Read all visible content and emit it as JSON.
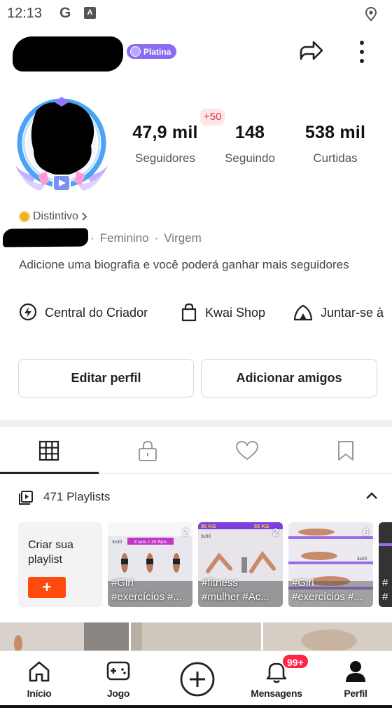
{
  "status_bar": {
    "time": "12:13",
    "icons": [
      "google-icon",
      "font-a-icon",
      "location-icon"
    ],
    "g_glyph": "G",
    "a_glyph": "A"
  },
  "profile": {
    "tier_badge": "Platina",
    "new_followers_badge": "+50",
    "stats": [
      {
        "value": "47,9 mil",
        "label": "Seguidores"
      },
      {
        "value": "148",
        "label": "Seguindo"
      },
      {
        "value": "538 mil",
        "label": "Curtidas"
      }
    ],
    "distintivo": "Distintivo",
    "gender": "Feminino",
    "sign": "Virgem",
    "separator": "·",
    "bio": "Adicione uma biografia e você poderá ganhar mais seguidores"
  },
  "shortcuts": [
    {
      "label": "Central do Criador",
      "icon": "lightning-circle-icon"
    },
    {
      "label": "Kwai Shop",
      "icon": "shopping-bag-icon"
    },
    {
      "label": "Juntar-se à",
      "icon": "tent-icon"
    }
  ],
  "actions": {
    "edit_profile": "Editar perfil",
    "add_friends": "Adicionar amigos"
  },
  "tabs": [
    {
      "name": "grid",
      "icon": "grid-icon",
      "active": true
    },
    {
      "name": "private",
      "icon": "lock-icon",
      "active": false
    },
    {
      "name": "liked",
      "icon": "heart-icon",
      "active": false
    },
    {
      "name": "saved",
      "icon": "bookmark-icon",
      "active": false
    }
  ],
  "playlists": {
    "header": "471 Playlists",
    "create_label": "Criar sua playlist",
    "create_button": "+",
    "items": [
      {
        "count": "2",
        "tag1": "#Girl",
        "tag2": "#exercícios #..."
      },
      {
        "count": "2",
        "tag1": "#fitness",
        "tag2": "#mulher #Ac..."
      },
      {
        "count": "6",
        "tag1": "#Girl",
        "tag2": "#exercícios #..."
      },
      {
        "count": "",
        "tag1": "#",
        "tag2": "#"
      }
    ],
    "thumb_text": {
      "c1_banner": "3 sets × 30 Rpts",
      "c1_reps": "3x30",
      "c2_weight_left": "85 KG",
      "c2_weight_right": "55 KG",
      "c2_reps": "3x30",
      "c3_reps": "3x20"
    }
  },
  "bottom_nav": [
    {
      "label": "Início",
      "icon": "home-icon"
    },
    {
      "label": "Jogo",
      "icon": "gamepad-icon"
    },
    {
      "label": "",
      "icon": "add-circle-icon"
    },
    {
      "label": "Mensagens",
      "icon": "bell-icon"
    },
    {
      "label": "Perfil",
      "icon": "person-icon"
    }
  ],
  "notifications_badge": "99+",
  "colors": {
    "accent": "#ff4a0e",
    "badge_red": "#ff2545",
    "tier_purple": "#8b6cf0"
  }
}
